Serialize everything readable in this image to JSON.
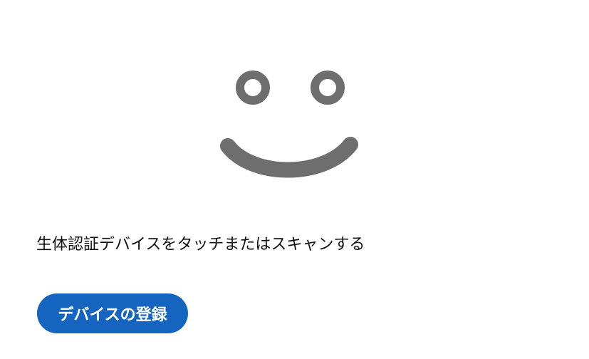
{
  "instruction": {
    "text": "生体認証デバイスをタッチまたはスキャンする"
  },
  "register_button": {
    "label": "デバイスの登録"
  },
  "icons": {
    "face": "smiley-face-icon"
  },
  "colors": {
    "icon_gray": "#6e6e6e",
    "button_blue": "#1565c0",
    "button_text": "#ffffff",
    "text": "#111111"
  }
}
